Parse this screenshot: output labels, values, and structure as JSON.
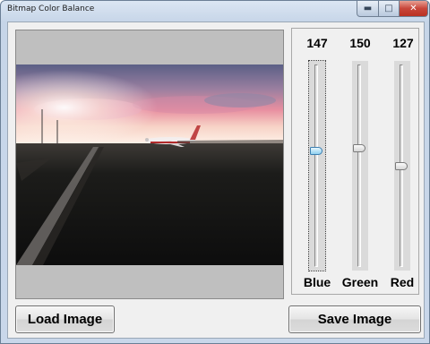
{
  "window": {
    "title": "Bitmap Color Balance",
    "controls": [
      "minimize-icon",
      "maximize-icon",
      "close-icon"
    ]
  },
  "sliders": [
    {
      "value": "147",
      "label": "Blue",
      "level": 147,
      "max": 255,
      "focused": true
    },
    {
      "value": "150",
      "label": "Green",
      "level": 150,
      "max": 255,
      "focused": false
    },
    {
      "value": "127",
      "label": "Red",
      "level": 127,
      "max": 255,
      "focused": false
    }
  ],
  "buttons": {
    "load": "Load Image",
    "save": "Save Image"
  },
  "colors": {
    "thumb_active": "#8fd0ef",
    "image_background": "#bfbfbf"
  }
}
